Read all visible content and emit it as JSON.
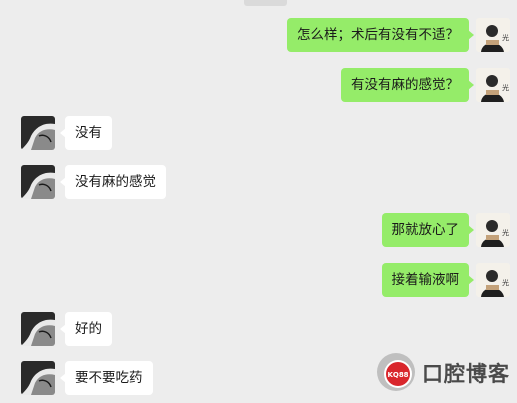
{
  "messages": [
    {
      "side": "me",
      "text": "怎么样；术后有没有不适？"
    },
    {
      "side": "me",
      "text": "有没有麻的感觉？"
    },
    {
      "side": "them",
      "text": "没有"
    },
    {
      "side": "them",
      "text": "没有麻的感觉"
    },
    {
      "side": "me",
      "text": "那就放心了"
    },
    {
      "side": "me",
      "text": "接着输液啊"
    },
    {
      "side": "them",
      "text": "好的"
    },
    {
      "side": "them",
      "text": "要不要吃药"
    }
  ],
  "watermark": {
    "logo_text": "KQ88",
    "brand_text": "口腔博客",
    "accent_color": "#d9262c"
  },
  "colors": {
    "background": "#ededed",
    "sent_bubble": "#95ec69",
    "received_bubble": "#ffffff"
  }
}
